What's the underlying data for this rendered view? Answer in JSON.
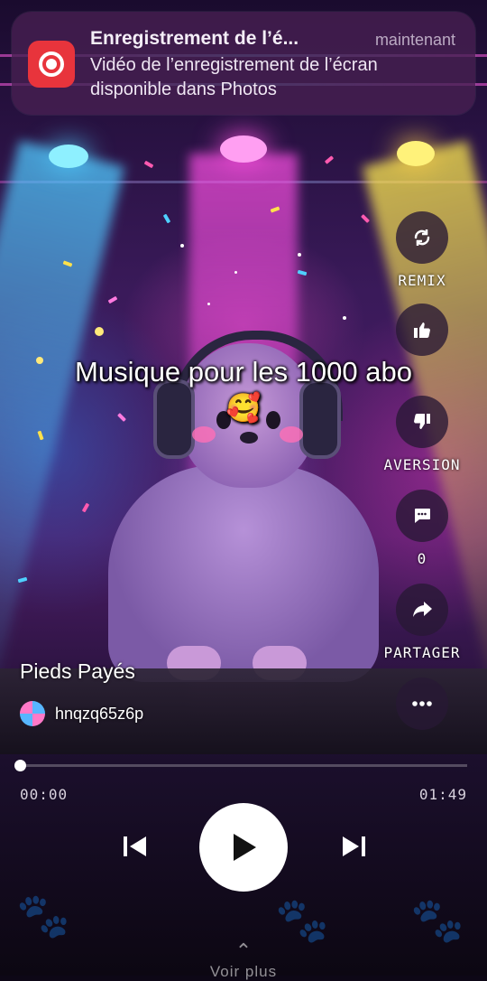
{
  "notification": {
    "app_icon": "screen-record-icon",
    "title": "Enregistrement de l’é...",
    "time": "maintenant",
    "message": "Vidéo de l’enregistrement de l’écran disponible dans Photos"
  },
  "caption": {
    "text": "Musique pour les 1000 abo",
    "emoji": "🥰"
  },
  "actions": {
    "remix": {
      "label": "REMIX",
      "icon": "remix-icon"
    },
    "like": {
      "label": "",
      "icon": "thumbs-up-icon"
    },
    "dislike": {
      "label": "AVERSION",
      "icon": "thumbs-down-icon"
    },
    "comments": {
      "label": "0",
      "icon": "comment-icon"
    },
    "share": {
      "label": "PARTAGER",
      "icon": "share-icon"
    },
    "more": {
      "label": "",
      "icon": "more-icon"
    }
  },
  "song": {
    "title": "Pieds Payés",
    "username": "hnqzq65z6p"
  },
  "player": {
    "current_time": "00:00",
    "total_time": "01:49",
    "progress": 0.0
  },
  "footer": {
    "more_label": "Voir plus"
  },
  "colors": {
    "accent_pink": "#ff59e0",
    "accent_blue": "#57b6ff",
    "record_red": "#e8343c"
  }
}
